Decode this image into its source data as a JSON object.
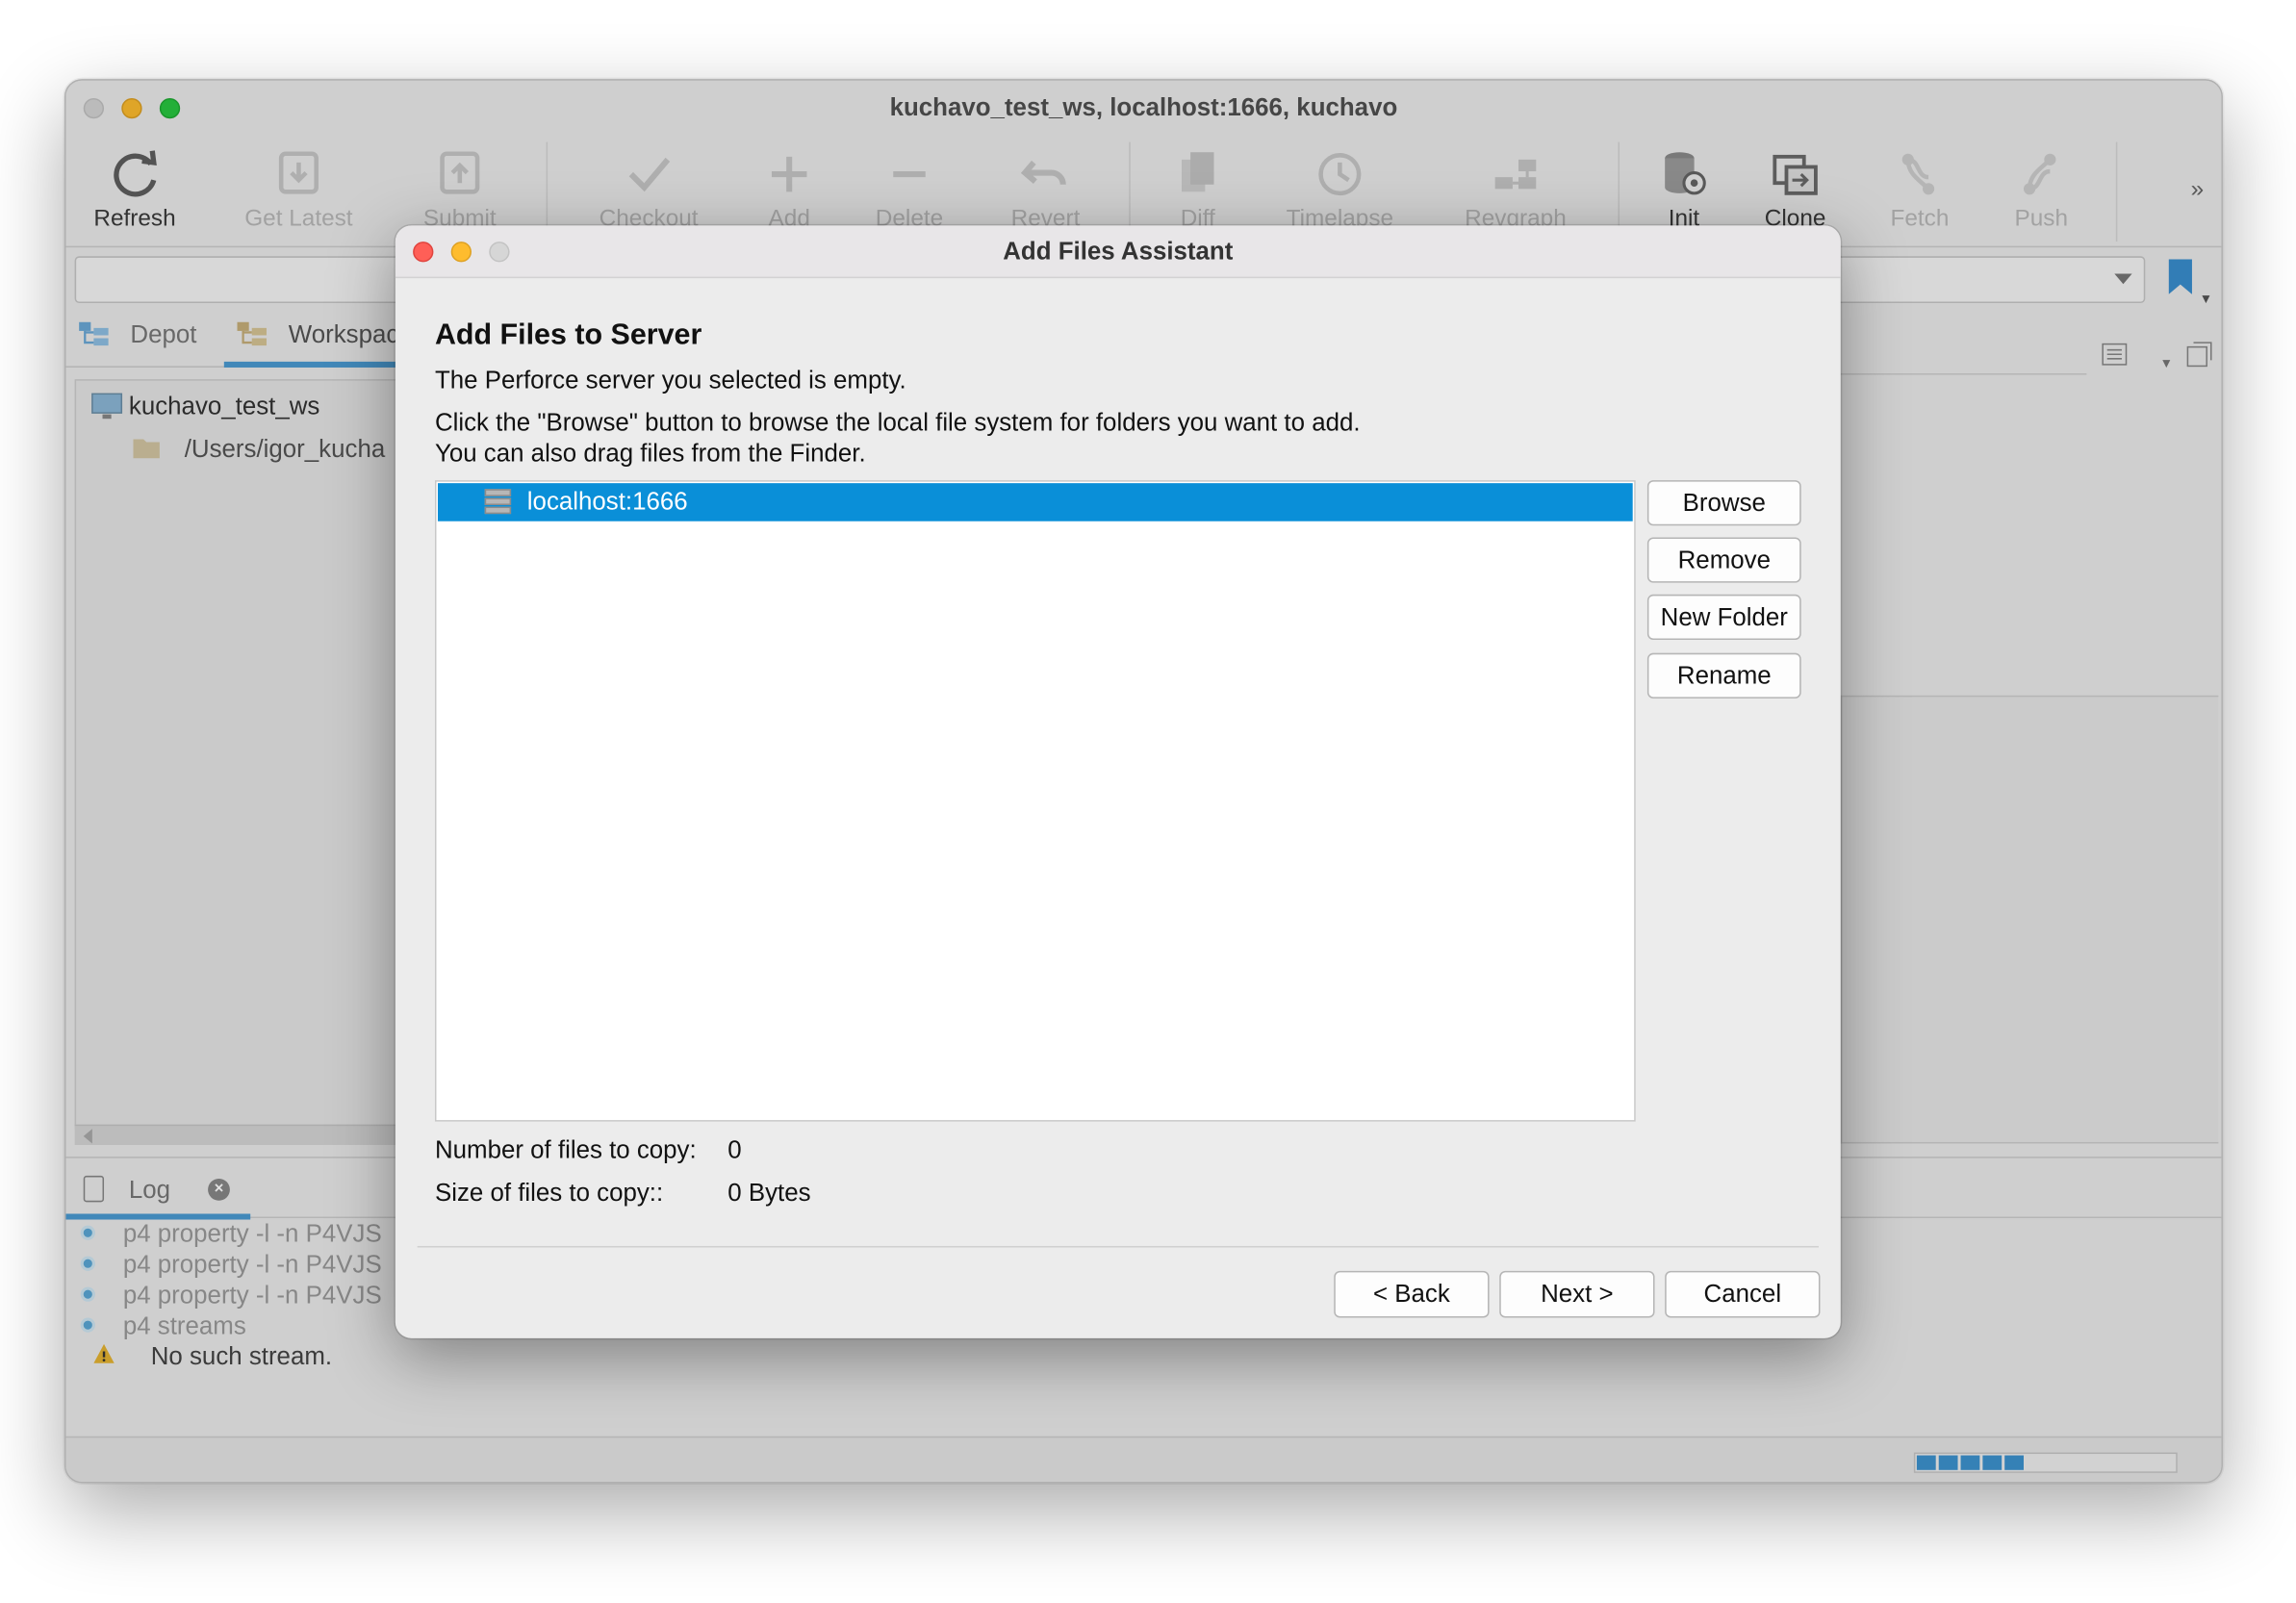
{
  "window": {
    "title": "kuchavo_test_ws,  localhost:1666,  kuchavo"
  },
  "toolbar": {
    "items": [
      {
        "label": "Refresh",
        "icon": "refresh-icon",
        "enabled": true
      },
      {
        "label": "Get Latest",
        "icon": "get-latest-icon",
        "enabled": false
      },
      {
        "label": "Submit",
        "icon": "submit-icon",
        "enabled": false
      },
      {
        "label": "Checkout",
        "icon": "checkout-icon",
        "enabled": false
      },
      {
        "label": "Add",
        "icon": "add-icon",
        "enabled": false
      },
      {
        "label": "Delete",
        "icon": "delete-icon",
        "enabled": false
      },
      {
        "label": "Revert",
        "icon": "revert-icon",
        "enabled": false
      },
      {
        "label": "Diff",
        "icon": "diff-icon",
        "enabled": false
      },
      {
        "label": "Timelapse",
        "icon": "timelapse-icon",
        "enabled": false
      },
      {
        "label": "Revgraph",
        "icon": "revgraph-icon",
        "enabled": false
      },
      {
        "label": "Init",
        "icon": "init-icon",
        "enabled": true
      },
      {
        "label": "Clone",
        "icon": "clone-icon",
        "enabled": true
      },
      {
        "label": "Fetch",
        "icon": "fetch-icon",
        "enabled": false
      },
      {
        "label": "Push",
        "icon": "push-icon",
        "enabled": false
      }
    ],
    "more": "»"
  },
  "left_tabs": {
    "depot": "Depot",
    "workspace": "Workspac"
  },
  "tree": {
    "workspace_name": "kuchavo_test_ws",
    "root_path": "/Users/igor_kucha"
  },
  "log": {
    "tab_label": "Log",
    "lines": [
      "p4 property -l -n P4VJS",
      "p4 property -l -n P4VJS",
      "p4 property -l -n P4VJS",
      "p4 streams"
    ],
    "warning": "No such stream."
  },
  "status": {
    "progress": 0.45
  },
  "dialog": {
    "title": "Add Files Assistant",
    "heading": "Add Files to Server",
    "line1": "The Perforce server you selected is empty.",
    "line2": "Click the \"Browse\" button to browse the local file system for folders you want to add.",
    "line3": "You can also drag files from the Finder.",
    "list_item": "localhost:1666",
    "buttons": {
      "browse": "Browse",
      "remove": "Remove",
      "new_folder": "New Folder",
      "rename": "Rename",
      "back": "< Back",
      "next": "Next >",
      "cancel": "Cancel"
    },
    "stats": {
      "count_label": "Number of files to copy:",
      "count_value": "0",
      "size_label": "Size of files to copy::",
      "size_value": "0 Bytes"
    }
  }
}
